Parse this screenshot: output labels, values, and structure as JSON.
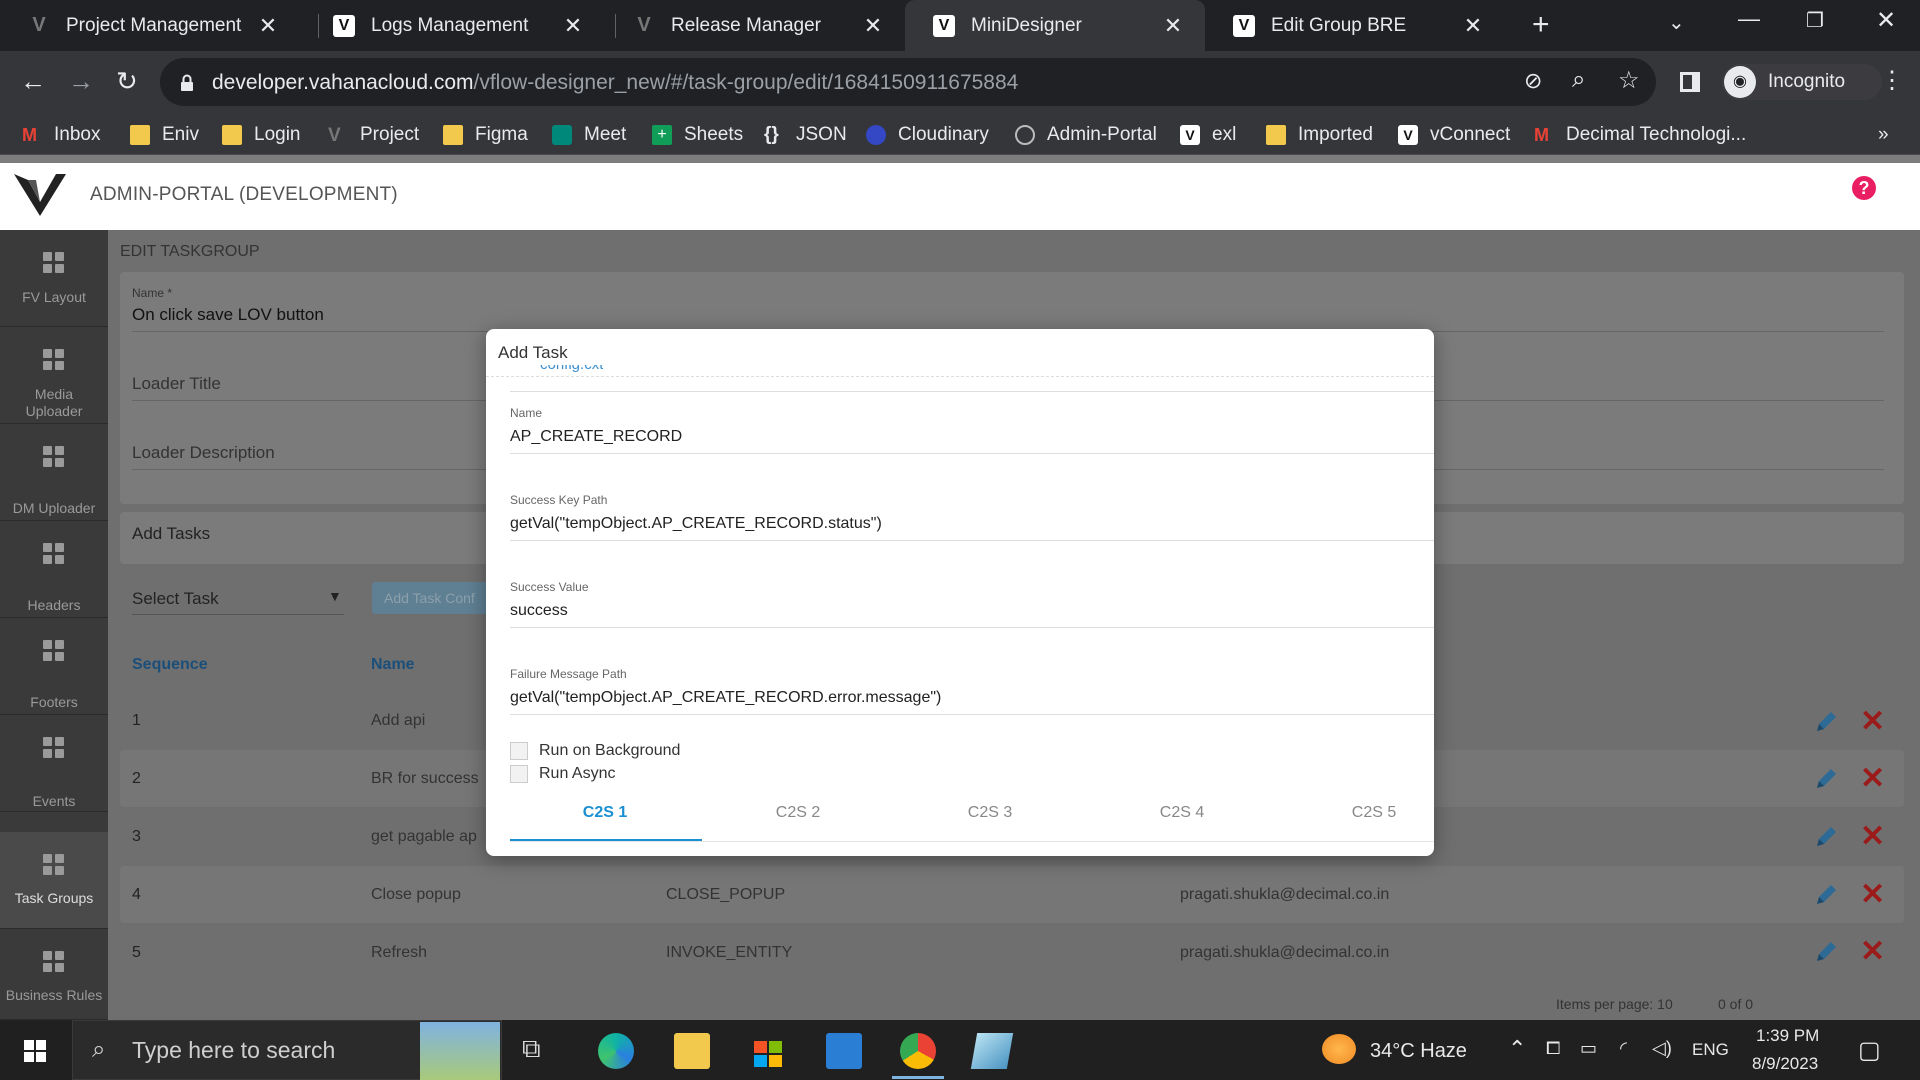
{
  "browser": {
    "tabs": [
      {
        "title": "Project Management"
      },
      {
        "title": "Logs Management"
      },
      {
        "title": "Release Manager"
      },
      {
        "title": "MiniDesigner"
      },
      {
        "title": "Edit Group BRE"
      }
    ],
    "url_host": "developer.vahanacloud.com",
    "url_path": "/vflow-designer_new/#/task-group/edit/1684150911675884",
    "profile_label": "Incognito",
    "bookmarks": [
      "Inbox",
      "Eniv",
      "Login",
      "Project",
      "Figma",
      "Meet",
      "Sheets",
      "JSON",
      "Cloudinary",
      "Admin-Portal",
      "exl",
      "Imported",
      "vConnect",
      "Decimal Technologi..."
    ],
    "more_bookmarks": "»"
  },
  "app": {
    "title": "ADMIN-PORTAL (DEVELOPMENT)",
    "help": "?",
    "sidebar": [
      {
        "label": "FV Layout"
      },
      {
        "label": "Media Uploader"
      },
      {
        "label": "DM Uploader"
      },
      {
        "label": "Headers"
      },
      {
        "label": "Footers"
      },
      {
        "label": "Events"
      },
      {
        "label": "Task Groups"
      },
      {
        "label": "Business Rules"
      }
    ],
    "page_title": "EDIT TASKGROUP",
    "form": {
      "name_label": "Name *",
      "name_value": "On click save LOV button",
      "loader_title_label": "Loader Title",
      "loader_description_label": "Loader Description"
    },
    "add_tasks": {
      "heading": "Add Tasks",
      "select_placeholder": "Select Task",
      "add_button": "Add Task Conf"
    },
    "table": {
      "headers": [
        "Sequence",
        "Name"
      ],
      "rows": [
        {
          "seq": "1",
          "name": "Add api",
          "type": "",
          "user": ""
        },
        {
          "seq": "2",
          "name": "BR for success",
          "type": "",
          "user": ""
        },
        {
          "seq": "3",
          "name": "get pagable ap",
          "type": "",
          "user": ""
        },
        {
          "seq": "4",
          "name": "Close popup",
          "type": "CLOSE_POPUP",
          "user": "pragati.shukla@decimal.co.in"
        },
        {
          "seq": "5",
          "name": "Refresh",
          "type": "INVOKE_ENTITY",
          "user": "pragati.shukla@decimal.co.in"
        }
      ],
      "items_per_page": "Items per page: 10",
      "range": "0 of 0"
    }
  },
  "modal": {
    "title": "Add Task",
    "scrolled_text": "config.cxt",
    "fields": [
      {
        "label": "Name",
        "value": "AP_CREATE_RECORD"
      },
      {
        "label": "Success Key Path",
        "value": "getVal(\"tempObject.AP_CREATE_RECORD.status\")"
      },
      {
        "label": "Success Value",
        "value": "success"
      },
      {
        "label": "Failure Message Path",
        "value": "getVal(\"tempObject.AP_CREATE_RECORD.error.message\")"
      }
    ],
    "checkboxes": [
      "Run on Background",
      "Run Async"
    ],
    "tabs": [
      "C2S 1",
      "C2S 2",
      "C2S 3",
      "C2S 4",
      "C2S 5"
    ],
    "active_tab": "C2S 1",
    "accent_color": "#1a8fd1"
  },
  "taskbar": {
    "search_placeholder": "Type here to search",
    "weather": "34°C  Haze",
    "language": "ENG",
    "time": "1:39 PM",
    "date": "8/9/2023"
  }
}
